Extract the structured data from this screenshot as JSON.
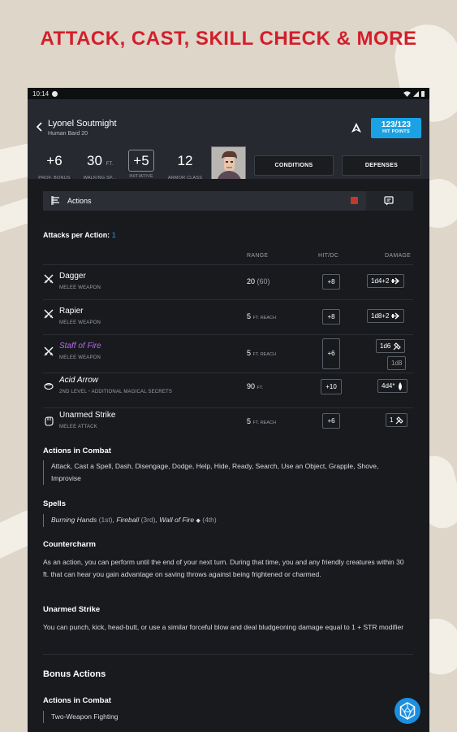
{
  "headline": "ATTACK, CAST, SKILL CHECK & MORE",
  "status_bar": {
    "time": "10:14"
  },
  "header": {
    "name": "Lyonel Soutmight",
    "subtitle": "Human Bard 20",
    "hp": {
      "value": "123/123",
      "label": "HIT POINTS"
    },
    "stats": [
      {
        "value": "+6",
        "unit": "",
        "label": "PROF. BONUS"
      },
      {
        "value": "30",
        "unit": "FT.",
        "label": "WALKING SP..."
      },
      {
        "value": "+5",
        "unit": "",
        "label": "INITIATIVE"
      },
      {
        "value": "12",
        "unit": "",
        "label": "ARMOR CLASS"
      }
    ],
    "buttons": {
      "conditions": "CONDITIONS",
      "defenses": "DEFENSES"
    }
  },
  "tab": {
    "label": "Actions"
  },
  "attacks_per_action": {
    "label": "Attacks per Action:",
    "value": "1"
  },
  "columns": {
    "range": "RANGE",
    "hit": "HIT/DC",
    "damage": "DAMAGE"
  },
  "rows": [
    {
      "name": "Dagger",
      "sub": "MELEE WEAPON",
      "range_main": "20",
      "range_extra": "(60)",
      "range_unit": "",
      "hit": "+8",
      "damage": "1d4+2",
      "icon": "sword-icon"
    },
    {
      "name": "Rapier",
      "sub": "MELEE WEAPON",
      "range_main": "5",
      "range_extra": "",
      "range_unit": "FT. REACH",
      "hit": "+8",
      "damage": "1d8+2",
      "icon": "sword-icon"
    },
    {
      "name": "Staff of Fire",
      "sub": "MELEE WEAPON",
      "range_main": "5",
      "range_extra": "",
      "range_unit": "FT. REACH",
      "hit": "+6",
      "damage": "1d6",
      "damage2": "1d8",
      "icon": "sword-icon"
    },
    {
      "name": "Acid Arrow",
      "sub_level": "2ND LEVEL",
      "sub_extra": "ADDITIONAL MAGICAL SECRETS",
      "range_main": "90",
      "range_extra": "",
      "range_unit": "FT.",
      "hit": "+10",
      "damage": "4d4*",
      "icon": "spell-icon"
    },
    {
      "name": "Unarmed Strike",
      "sub": "MELEE ATTACK",
      "range_main": "5",
      "range_extra": "",
      "range_unit": "FT. REACH",
      "hit": "+6",
      "damage": "1",
      "icon": "fist-icon"
    }
  ],
  "actions_in_combat": {
    "title": "Actions in Combat",
    "text": "Attack, Cast a Spell, Dash, Disengage, Dodge, Help, Hide, Ready, Search, Use an Object, Grapple, Shove, Improvise"
  },
  "spells": {
    "title": "Spells",
    "items": [
      {
        "name": "Burning Hands",
        "level": "(1st)"
      },
      {
        "name": "Fireball",
        "level": "(3rd)"
      },
      {
        "name": "Wall of Fire",
        "level": "(4th)"
      }
    ]
  },
  "countercharm": {
    "title": "Countercharm",
    "text": "As an action, you can perform until the end of your next turn. During that time, you and any friendly creatures within 30 ft. that can hear you gain advantage on saving throws against being frightened or charmed."
  },
  "unarmed_strike": {
    "title": "Unarmed Strike",
    "text": "You can punch, kick, head-butt, or use a similar forceful blow and deal bludgeoning damage equal to 1 + STR modifier"
  },
  "bonus_actions": {
    "title": "Bonus Actions"
  },
  "bonus_combat": {
    "title": "Actions in Combat",
    "text": "Two-Weapon Fighting"
  }
}
